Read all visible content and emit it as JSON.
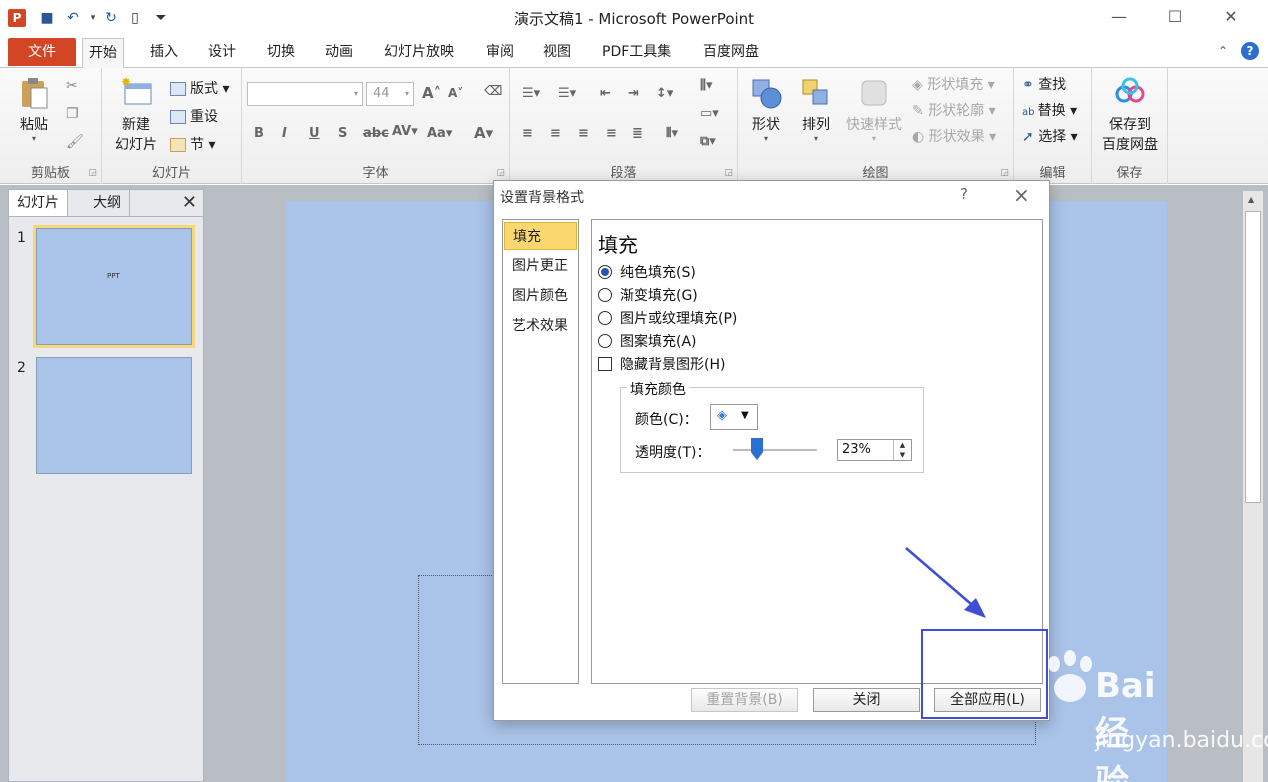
{
  "app": {
    "title": "演示文稿1 - Microsoft PowerPoint",
    "logo_letter": "P"
  },
  "quick_access": [
    "save-icon",
    "undo-icon",
    "redo-icon",
    "new-icon",
    "customize-icon"
  ],
  "tabs": [
    {
      "label": "文件"
    },
    {
      "label": "开始"
    },
    {
      "label": "插入"
    },
    {
      "label": "设计"
    },
    {
      "label": "切换"
    },
    {
      "label": "动画"
    },
    {
      "label": "幻灯片放映"
    },
    {
      "label": "审阅"
    },
    {
      "label": "视图"
    },
    {
      "label": "PDF工具集"
    },
    {
      "label": "百度网盘"
    }
  ],
  "ribbon": {
    "clipboard": {
      "label": "剪贴板",
      "paste": "粘贴"
    },
    "slides": {
      "label": "幻灯片",
      "new_slide_1": "新建",
      "new_slide_2": "幻灯片",
      "layout": "版式",
      "reset": "重设",
      "section": "节"
    },
    "font": {
      "label": "字体",
      "size": "44"
    },
    "paragraph": {
      "label": "段落"
    },
    "drawing": {
      "label": "绘图",
      "shapes": "形状",
      "arrange": "排列",
      "quick_styles": "快速样式",
      "shape_fill": "形状填充",
      "shape_outline": "形状轮廓",
      "shape_effects": "形状效果"
    },
    "editing": {
      "label": "编辑",
      "find": "查找",
      "replace": "替换",
      "select": "选择"
    },
    "save": {
      "label": "保存",
      "save_1": "保存到",
      "save_2": "百度网盘"
    }
  },
  "left_pane": {
    "tab_slides": "幻灯片",
    "tab_outline": "大纲",
    "slides": [
      {
        "number": "1",
        "text": "PPT"
      },
      {
        "number": "2",
        "text": ""
      }
    ]
  },
  "dialog": {
    "title": "设置背景格式",
    "help": "?",
    "nav": [
      "填充",
      "图片更正",
      "图片颜色",
      "艺术效果"
    ],
    "section_title": "填充",
    "options": [
      {
        "label": "纯色填充(S)",
        "selected": true
      },
      {
        "label": "渐变填充(G)",
        "selected": false
      },
      {
        "label": "图片或纹理填充(P)",
        "selected": false
      },
      {
        "label": "图案填充(A)",
        "selected": false
      }
    ],
    "hide_graphics": "隐藏背景图形(H)",
    "fill_color_legend": "填充颜色",
    "color_label": "颜色(C)：",
    "transparency_label": "透明度(T)：",
    "transparency_value": "23%",
    "transparency_fraction": 0.23,
    "buttons": {
      "reset": "重置背景(B)",
      "close": "关闭",
      "apply_all": "全部应用(L)"
    }
  },
  "watermark": {
    "brand": "Bai 经验",
    "url": "jingyan.baidu.com"
  },
  "colors": {
    "accent": "#d24625",
    "slide_bg": "#a9c3e9",
    "highlight": "#fbd76f",
    "annotation": "#3f4fd3"
  }
}
